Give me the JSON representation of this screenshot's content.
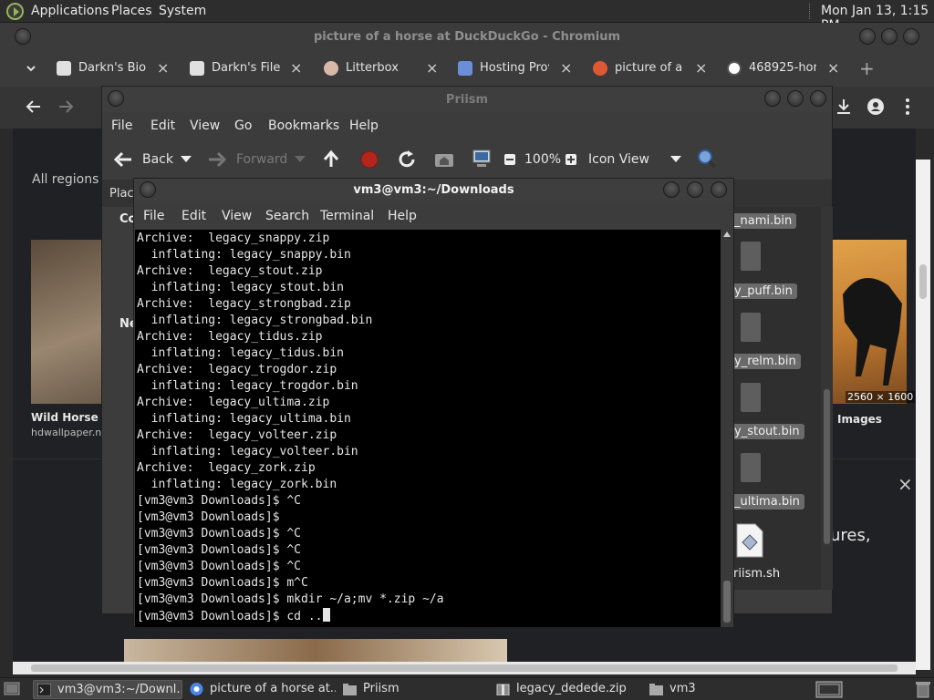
{
  "top_panel": {
    "menus": [
      "Applications",
      "Places",
      "System"
    ],
    "clock": "Mon Jan 13,  1:15 PM"
  },
  "chromium": {
    "title": "picture of a horse at DuckDuckGo - Chromium",
    "tabs": [
      {
        "label": "Darkn's Bio",
        "icon": "page-icon",
        "color": "#e0e0e0"
      },
      {
        "label": "Darkn's File l",
        "icon": "download-icon",
        "color": "#e0e0e0"
      },
      {
        "label": "Litterbox",
        "icon": "litterbox-icon",
        "color": "#d9b8a8"
      },
      {
        "label": "Hosting Prov",
        "icon": "hosting-icon",
        "color": "#6a8fd8"
      },
      {
        "label": "picture of a h",
        "icon": "duckduckgo-icon",
        "color": "#de5833"
      },
      {
        "label": "468925-hor",
        "icon": "wordpress-icon",
        "color": "#ffffff"
      }
    ],
    "page": {
      "region": "All regions",
      "left_image_caption": "Wild Horse W",
      "left_image_source": "hdwallpaper.n",
      "right_image_dims": "2560 × 1600",
      "right_image_caption": "Images",
      "snippet": "ures,"
    }
  },
  "prism": {
    "title": "Priism",
    "menu": [
      "File",
      "Edit",
      "View",
      "Go",
      "Bookmarks",
      "Help"
    ],
    "toolbar": {
      "back": "Back",
      "forward": "Forward",
      "zoom": "100%",
      "view_mode": "Icon View"
    },
    "location_stub": "Plac",
    "sidebar_stub": [
      "Co",
      "Ne"
    ],
    "files": [
      "_nami.bin",
      "y_puff.bin",
      "y_relm.bin",
      "y_stout.bin",
      "_ultima.bin",
      "riism.sh"
    ]
  },
  "terminal": {
    "title": "vm3@vm3:~/Downloads",
    "menu": [
      "File",
      "Edit",
      "View",
      "Search",
      "Terminal",
      "Help"
    ],
    "lines": [
      "Archive:  legacy_snappy.zip",
      "  inflating: legacy_snappy.bin",
      "Archive:  legacy_stout.zip",
      "  inflating: legacy_stout.bin",
      "Archive:  legacy_strongbad.zip",
      "  inflating: legacy_strongbad.bin",
      "Archive:  legacy_tidus.zip",
      "  inflating: legacy_tidus.bin",
      "Archive:  legacy_trogdor.zip",
      "  inflating: legacy_trogdor.bin",
      "Archive:  legacy_ultima.zip",
      "  inflating: legacy_ultima.bin",
      "Archive:  legacy_volteer.zip",
      "  inflating: legacy_volteer.bin",
      "Archive:  legacy_zork.zip",
      "  inflating: legacy_zork.bin",
      "[vm3@vm3 Downloads]$ ^C",
      "[vm3@vm3 Downloads]$",
      "[vm3@vm3 Downloads]$ ^C",
      "[vm3@vm3 Downloads]$ ^C",
      "[vm3@vm3 Downloads]$ ^C",
      "[vm3@vm3 Downloads]$ m^C",
      "[vm3@vm3 Downloads]$ mkdir ~/a;mv *.zip ~/a"
    ],
    "prompt_line": "[vm3@vm3 Downloads]$ cd .."
  },
  "taskbar": {
    "tasks": [
      {
        "label": "vm3@vm3:~/Downl...",
        "icon": "terminal-icon",
        "active": true
      },
      {
        "label": "picture of a horse at...",
        "icon": "chromium-icon",
        "active": false
      },
      {
        "label": "Priism",
        "icon": "folder-icon",
        "active": false
      },
      {
        "label": "legacy_dedede.zip",
        "icon": "archive-icon",
        "active": false
      },
      {
        "label": "vm3",
        "icon": "folder-icon",
        "active": false
      }
    ]
  }
}
